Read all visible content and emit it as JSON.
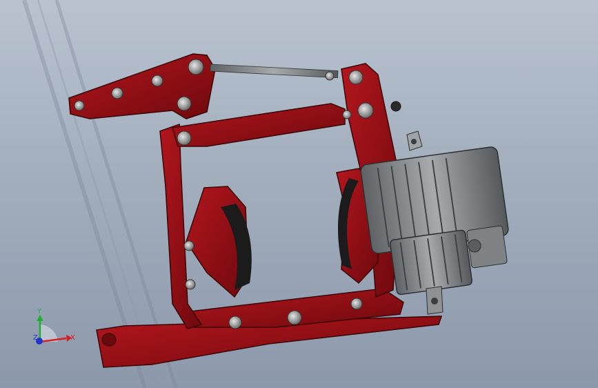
{
  "viewport": {
    "background_top": "#b9c3d0",
    "background_bottom": "#8c99ab"
  },
  "model": {
    "part_color": "#8e0d12",
    "part_highlight": "#b0151b",
    "thruster_color": "#8a8d8f",
    "pin_color": "#c9c9c9",
    "pad_color": "#1b1b1b"
  },
  "triad": {
    "x_label": "X",
    "y_label": "Y",
    "z_label": "Z",
    "x_color": "#d42020",
    "y_color": "#1fae2f",
    "z_color": "#2136c7"
  }
}
